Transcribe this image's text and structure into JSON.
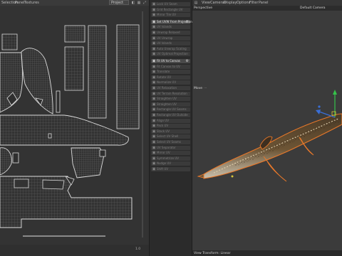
{
  "uv_editor": {
    "menu": [
      "Selection",
      "Panel",
      "Textures"
    ],
    "projection_select": "Project",
    "zoom_readout": "1.0"
  },
  "tools": {
    "rows": [
      {
        "label": "Lock UV Seam",
        "active": false
      },
      {
        "label": "Grid Rectangle UV",
        "active": false
      },
      {
        "label": "Mirror Tile UV",
        "active": false
      },
      {
        "label": "Set UVW From Projection",
        "active": true
      },
      {
        "label": "UV Islands",
        "active": false
      },
      {
        "label": "Unwrap Relaxed",
        "active": false
      },
      {
        "label": "UV Unwrap",
        "active": false
      },
      {
        "label": "UV Islands",
        "active": false
      },
      {
        "label": "Auto Unwrap Scaling",
        "active": false
      },
      {
        "label": "UV Optimal Projection",
        "active": false
      },
      {
        "label": "Fit UV to Canvas",
        "active": true
      },
      {
        "label": "Fit Canvas to UV",
        "active": false
      },
      {
        "label": "Translate",
        "active": false
      },
      {
        "label": "Rotate UV",
        "active": false
      },
      {
        "label": "Normalize UV",
        "active": false
      },
      {
        "label": "UV Relaxation",
        "active": false
      },
      {
        "label": "UV Terrain Resolution",
        "active": false
      },
      {
        "label": "Straighten UV",
        "active": false
      },
      {
        "label": "Straighten UV",
        "active": false
      },
      {
        "label": "Rectangle UV Seams",
        "active": false
      },
      {
        "label": "Rectangle UV Outside",
        "active": false
      },
      {
        "label": "Align UV",
        "active": false
      },
      {
        "label": "Pack UV",
        "active": false
      },
      {
        "label": "Stack UV",
        "active": false
      },
      {
        "label": "Select UV Shell",
        "active": false
      },
      {
        "label": "Select UV Seams",
        "active": false
      },
      {
        "label": "UV Separator",
        "active": false
      },
      {
        "label": "Mirror UV",
        "active": false
      },
      {
        "label": "Symmetrize UV",
        "active": false
      },
      {
        "label": "Nudge UV",
        "active": false
      },
      {
        "label": "Shift UV",
        "active": false
      }
    ]
  },
  "viewport": {
    "menu": [
      "View",
      "Cameras",
      "Display",
      "Options",
      "Filter",
      "Panel"
    ],
    "view_name": "Perspective",
    "camera_name": "Default Camera",
    "move_label": "Move",
    "footer": "View Transform: Linear"
  },
  "colors": {
    "uv_line": "#d9d9d9",
    "axis_y": "#35c24a",
    "axis_z": "#3a6fd8",
    "selection_outline": "#e8782a"
  }
}
